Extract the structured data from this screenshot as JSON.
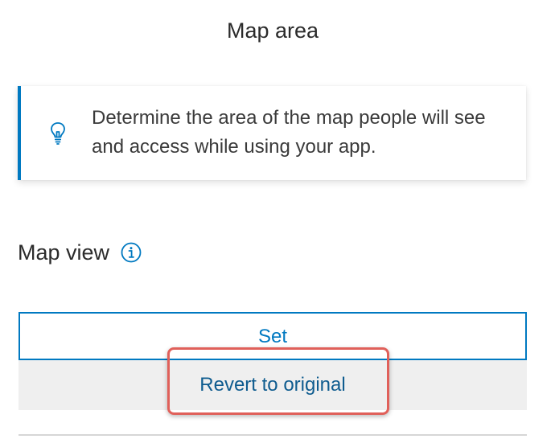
{
  "panel": {
    "title": "Map area"
  },
  "tip": {
    "icon": "lightbulb-icon",
    "text": "Determine the area of the map people will see and access while using your app.",
    "accent_color": "#0079c1"
  },
  "map_view": {
    "label": "Map view",
    "info_icon": "info-icon",
    "set_label": "Set",
    "revert_label": "Revert to original"
  },
  "colors": {
    "accent": "#0079c1",
    "highlight": "#e0605a"
  }
}
